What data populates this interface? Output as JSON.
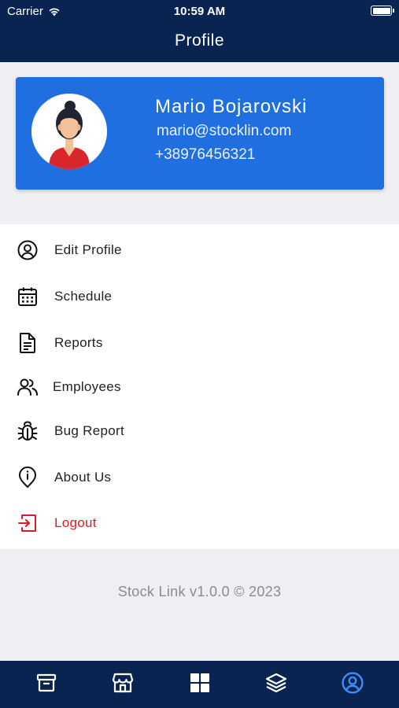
{
  "status_bar": {
    "carrier": "Carrier",
    "time": "10:59 AM"
  },
  "header": {
    "title": "Profile"
  },
  "profile": {
    "name": "Mario Bojarovski",
    "email": "mario@stocklin.com",
    "phone": "+38976456321"
  },
  "menu": [
    {
      "label": "Edit Profile",
      "icon": "user-circle-icon"
    },
    {
      "label": "Schedule",
      "icon": "calendar-icon"
    },
    {
      "label": "Reports",
      "icon": "document-icon"
    },
    {
      "label": "Employees",
      "icon": "users-icon"
    },
    {
      "label": "Bug Report",
      "icon": "bug-icon"
    },
    {
      "label": "About Us",
      "icon": "info-pin-icon"
    },
    {
      "label": "Logout",
      "icon": "logout-icon"
    }
  ],
  "footer": {
    "text": "Stock Link v1.0.0 © 2023"
  },
  "tabbar": {
    "tabs": [
      "archive-icon",
      "store-icon",
      "grid-icon",
      "layers-icon",
      "profile-icon"
    ],
    "active": "profile-icon"
  },
  "colors": {
    "navy": "#0a2451",
    "card_blue": "#1f6fe0",
    "logout_red": "#e11b22",
    "active_tab": "#3d8ef7"
  }
}
